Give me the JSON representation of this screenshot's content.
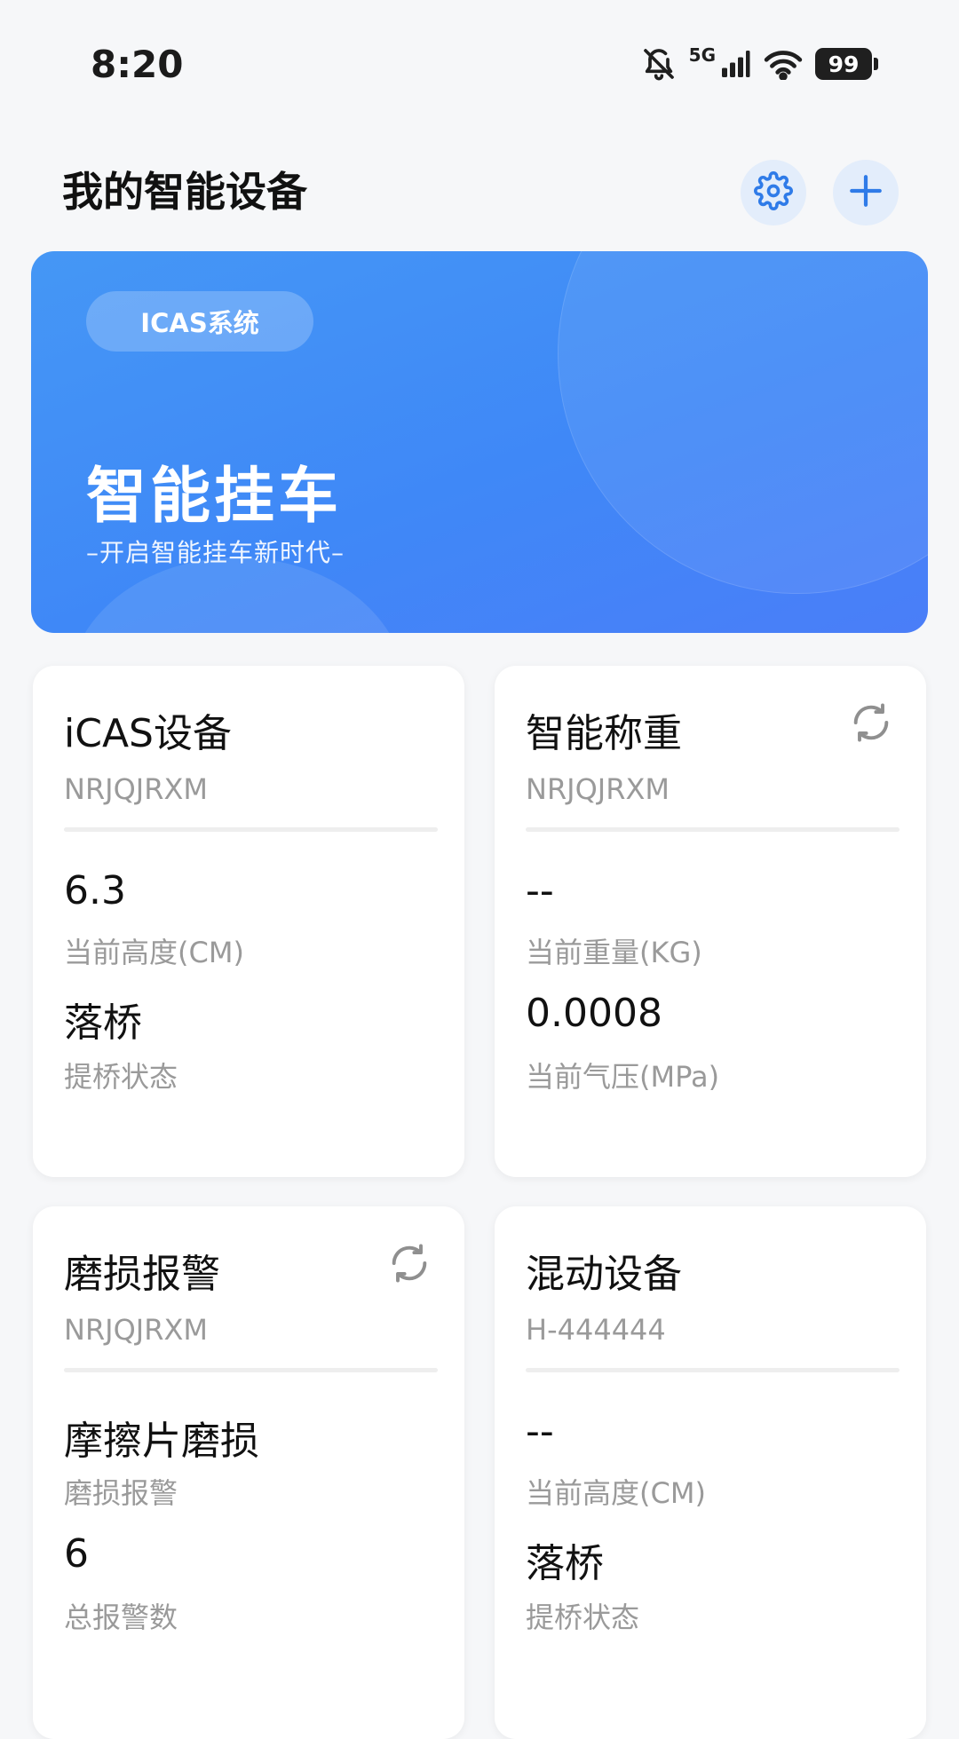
{
  "status_bar": {
    "time": "8:20",
    "network": "5G",
    "battery": "99",
    "icons": [
      "bell-off-icon",
      "signal-icon",
      "wifi-icon",
      "battery-icon"
    ]
  },
  "header": {
    "title": "我的智能设备",
    "settings_icon": "gear-icon",
    "add_icon": "plus-icon",
    "accent_color": "#2f7be8"
  },
  "banner": {
    "pill": "ICAS系统",
    "title": "智能挂车",
    "subtitle": "–开启智能挂车新时代–"
  },
  "devices": [
    {
      "name": "iCAS设备",
      "id": "NRJQJRXM",
      "refresh": false,
      "metrics": [
        {
          "value": "6.3",
          "label": "当前高度(CM)"
        },
        {
          "value": "落桥",
          "label": "提桥状态"
        }
      ]
    },
    {
      "name": "智能称重",
      "id": "NRJQJRXM",
      "refresh": true,
      "metrics": [
        {
          "value": "--",
          "label": "当前重量(KG)"
        },
        {
          "value": "0.0008",
          "label": "当前气压(MPa)"
        }
      ]
    },
    {
      "name": "磨损报警",
      "id": "NRJQJRXM",
      "refresh": true,
      "metrics": [
        {
          "value": "摩擦片磨损",
          "label": "磨损报警"
        },
        {
          "value": "6",
          "label": "总报警数"
        }
      ]
    },
    {
      "name": "混动设备",
      "id": "H-444444",
      "refresh": false,
      "metrics": [
        {
          "value": "--",
          "label": "当前高度(CM)"
        },
        {
          "value": "落桥",
          "label": "提桥状态"
        }
      ]
    }
  ]
}
